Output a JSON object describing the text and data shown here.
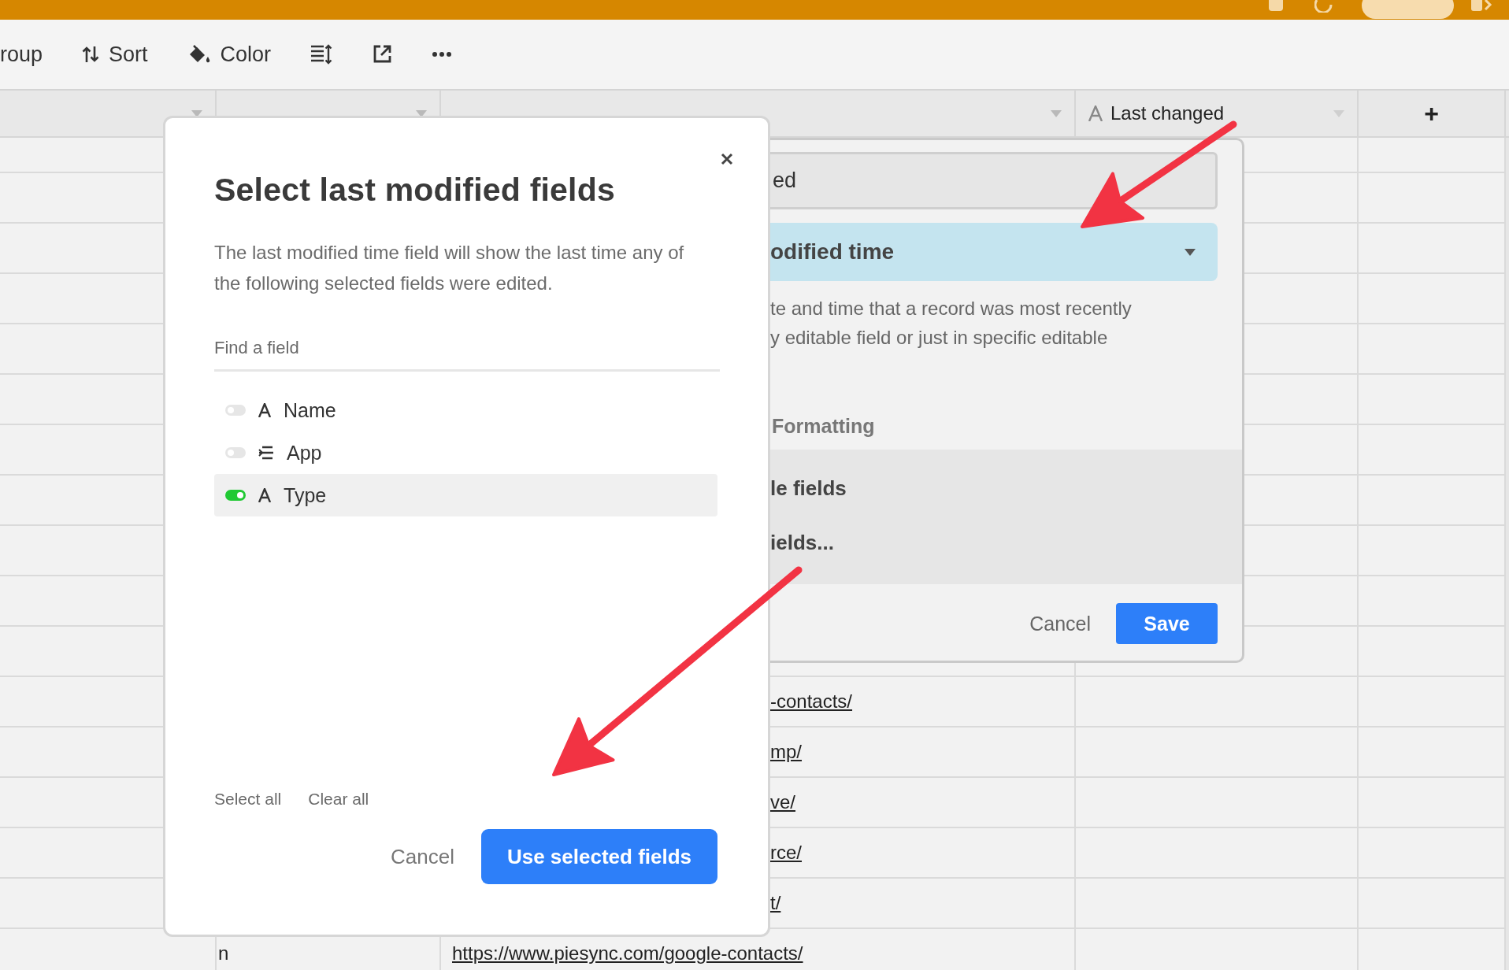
{
  "top_bar": {
    "actions": [
      {
        "kind": "square"
      },
      {
        "kind": "history"
      },
      {
        "kind": "share"
      },
      {
        "kind": "panel"
      }
    ]
  },
  "toolbar": {
    "items": [
      {
        "kind": "group",
        "label": "roup"
      },
      {
        "kind": "sort",
        "label": "Sort"
      },
      {
        "kind": "color",
        "label": "Color"
      },
      {
        "kind": "row-height"
      },
      {
        "kind": "share"
      },
      {
        "kind": "more"
      }
    ]
  },
  "grid": {
    "columns": [
      {
        "kind": "hidden"
      },
      {
        "kind": "hidden"
      },
      {
        "kind": "hidden"
      },
      {
        "kind": "text",
        "label": "Last changed"
      },
      {
        "kind": "add",
        "label": "+"
      }
    ],
    "rows": [
      {
        "kind": "partial",
        "url": "-contacts/"
      },
      {
        "kind": "partial",
        "url": "mp/"
      },
      {
        "kind": "partial",
        "url": "ve/"
      },
      {
        "kind": "partial",
        "url": "rce/"
      },
      {
        "kind": "partial",
        "url": "t/"
      },
      {
        "kind": "full",
        "column_2": "n",
        "url": "https://www.piesync.com/google-contacts/"
      }
    ]
  },
  "field_popup": {
    "name_value": "ed",
    "type_label": "odified time",
    "description": [
      "te and time that a record was most recently",
      "y editable field or just in specific editable"
    ],
    "section_label": "Formatting",
    "options": [
      "le fields",
      "ields..."
    ],
    "cancel": "Cancel",
    "save": "Save"
  },
  "dialog": {
    "title": "Select last modified fields",
    "description": "The last modified time field will show the last time any of the following selected fields were edited.",
    "search": {
      "placeholder": "Find a field"
    },
    "fields": [
      {
        "name": "Name",
        "kind": "text",
        "on": false,
        "selected": false
      },
      {
        "name": "App",
        "kind": "link",
        "on": false,
        "selected": false
      },
      {
        "name": "Type",
        "kind": "text",
        "on": true,
        "selected": true
      }
    ],
    "select_all": "Select all",
    "clear_all": "Clear all",
    "cancel": "Cancel",
    "confirm": "Use selected fields"
  }
}
